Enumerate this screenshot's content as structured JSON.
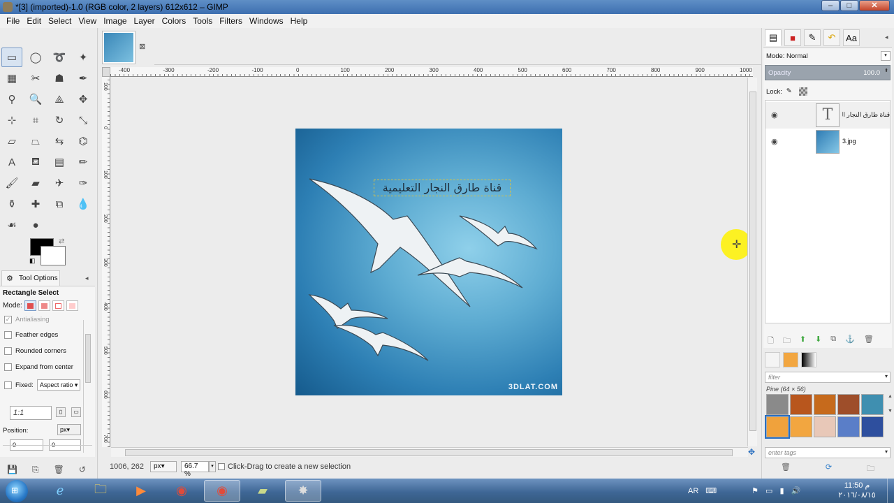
{
  "window": {
    "title": "*[3] (imported)-1.0 (RGB color, 2 layers) 612x612 – GIMP",
    "min_label": "–",
    "max_label": "□",
    "close_label": "✕"
  },
  "menu": [
    "File",
    "Edit",
    "Select",
    "View",
    "Image",
    "Layer",
    "Colors",
    "Tools",
    "Filters",
    "Windows",
    "Help"
  ],
  "toolbox": {
    "tools": [
      {
        "name": "rect-select",
        "glyph": "▭"
      },
      {
        "name": "ellipse-select",
        "glyph": "◯"
      },
      {
        "name": "free-select",
        "glyph": "➰"
      },
      {
        "name": "fuzzy-select",
        "glyph": "✦"
      },
      {
        "name": "select-by-color",
        "glyph": "▦"
      },
      {
        "name": "scissors-select",
        "glyph": "✂"
      },
      {
        "name": "foreground-select",
        "glyph": "☗"
      },
      {
        "name": "paths",
        "glyph": "✒"
      },
      {
        "name": "color-picker",
        "glyph": "⚲"
      },
      {
        "name": "zoom",
        "glyph": "🔍"
      },
      {
        "name": "measure",
        "glyph": "⟁"
      },
      {
        "name": "move",
        "glyph": "✥"
      },
      {
        "name": "align",
        "glyph": "⊹"
      },
      {
        "name": "crop",
        "glyph": "⌗"
      },
      {
        "name": "rotate",
        "glyph": "↻"
      },
      {
        "name": "scale",
        "glyph": "⤡"
      },
      {
        "name": "shear",
        "glyph": "▱"
      },
      {
        "name": "perspective",
        "glyph": "⏢"
      },
      {
        "name": "flip",
        "glyph": "⇆"
      },
      {
        "name": "cage-transform",
        "glyph": "⌬"
      },
      {
        "name": "text",
        "glyph": "A"
      },
      {
        "name": "bucket-fill",
        "glyph": "⛾"
      },
      {
        "name": "blend",
        "glyph": "▤"
      },
      {
        "name": "pencil",
        "glyph": "✏"
      },
      {
        "name": "paintbrush",
        "glyph": "🖌"
      },
      {
        "name": "eraser",
        "glyph": "▰"
      },
      {
        "name": "airbrush",
        "glyph": "✈"
      },
      {
        "name": "ink",
        "glyph": "✑"
      },
      {
        "name": "clone",
        "glyph": "⚱"
      },
      {
        "name": "heal",
        "glyph": "✚"
      },
      {
        "name": "perspective-clone",
        "glyph": "⧉"
      },
      {
        "name": "blur",
        "glyph": "💧"
      },
      {
        "name": "smudge",
        "glyph": "☙"
      },
      {
        "name": "dodge-burn",
        "glyph": "●"
      }
    ],
    "fg_color": "#000000",
    "bg_color": "#ffffff"
  },
  "tool_options": {
    "tab_label": "Tool Options",
    "tool_name": "Rectangle Select",
    "mode_label": "Mode:",
    "antialiasing": "Antialiasing",
    "feather_edges": "Feather edges",
    "rounded_corners": "Rounded corners",
    "expand_from_center": "Expand from center",
    "fixed_label": "Fixed:",
    "fixed_value": "Aspect ratio",
    "ratio_value": "1:1",
    "position_label": "Position:",
    "position_unit": "px",
    "pos_x": "0",
    "pos_y": "0"
  },
  "canvas": {
    "ruler_h": [
      "-400",
      "-300",
      "-200",
      "-100",
      "0",
      "100",
      "200",
      "300",
      "400",
      "500",
      "600",
      "700",
      "800",
      "900",
      "1000"
    ],
    "ruler_v": [
      "100",
      "0",
      "100",
      "200",
      "300",
      "400",
      "500",
      "600",
      "700"
    ],
    "text_layer": "قناة طارق النجار التعليمية",
    "watermark": "3DLAT.COM"
  },
  "status": {
    "coords": "1006, 262",
    "unit": "px",
    "zoom": "66.7 %",
    "message": "Click-Drag to create a new selection"
  },
  "layers": {
    "mode_label": "Mode:",
    "mode_value": "Normal",
    "opacity_label": "Opacity",
    "opacity_value": "100.0",
    "lock_label": "Lock:",
    "items": [
      {
        "name": "قناة طارق النجار التعليمية",
        "type": "text"
      },
      {
        "name": "3.jpg",
        "type": "image"
      }
    ]
  },
  "patterns": {
    "filter_placeholder": "filter",
    "selected_name": "Pine (64 × 56)",
    "tags_placeholder": "enter tags",
    "swatches": [
      "#8a8a8a",
      "#b8561d",
      "#c66a1c",
      "#9e4e2a",
      "#3f8fb0",
      "#f0a23c",
      "#f2a640",
      "#e8c8b8",
      "#5a7ec8",
      "#2e4f9e"
    ]
  },
  "taskbar": {
    "lang": "AR",
    "time": "11:50 م",
    "date": "٢٠١٦/٠٨/١٥"
  }
}
